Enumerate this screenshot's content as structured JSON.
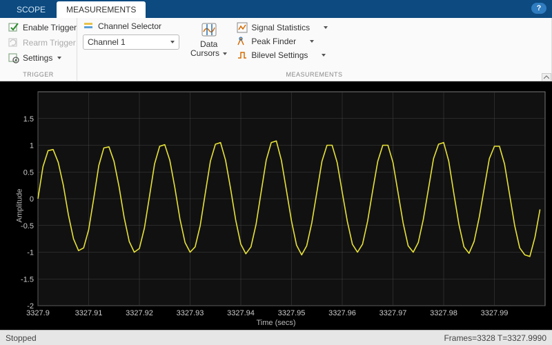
{
  "tabs": {
    "scope": "SCOPE",
    "measurements": "MEASUREMENTS"
  },
  "help_icon": "?",
  "trigger": {
    "enable": "Enable Trigger",
    "rearm": "Rearm Trigger",
    "settings": "Settings",
    "group": "TRIGGER"
  },
  "measurements": {
    "channel_selector": "Channel Selector",
    "channel_value": "Channel 1",
    "data_cursors": "Data",
    "data_cursors2": "Cursors",
    "signal_stats": "Signal Statistics",
    "peak_finder": "Peak Finder",
    "bilevel": "Bilevel Settings",
    "group": "MEASUREMENTS"
  },
  "status": {
    "left": "Stopped",
    "right": "Frames=3328  T=3327.9990"
  },
  "axes": {
    "ylabel": "Amplitude",
    "xlabel": "Time (secs)"
  },
  "chart_data": {
    "type": "line",
    "title": "",
    "xlabel": "Time (secs)",
    "ylabel": "Amplitude",
    "xlim": [
      3327.9,
      3328.0
    ],
    "ylim": [
      -2,
      2
    ],
    "yticks": [
      -2,
      -1.5,
      -1,
      -0.5,
      0,
      0.5,
      1,
      1.5
    ],
    "xticks": [
      3327.9,
      3327.91,
      3327.92,
      3327.93,
      3327.94,
      3327.95,
      3327.96,
      3327.97,
      3327.98,
      3327.99
    ],
    "series": [
      {
        "name": "Channel 1",
        "color": "#e8e337",
        "x": [
          3327.9,
          3327.901,
          3327.902,
          3327.903,
          3327.904,
          3327.905,
          3327.906,
          3327.907,
          3327.908,
          3327.909,
          3327.91,
          3327.911,
          3327.912,
          3327.913,
          3327.914,
          3327.915,
          3327.916,
          3327.917,
          3327.918,
          3327.919,
          3327.92,
          3327.921,
          3327.922,
          3327.923,
          3327.924,
          3327.925,
          3327.926,
          3327.927,
          3327.928,
          3327.929,
          3327.93,
          3327.931,
          3327.932,
          3327.933,
          3327.934,
          3327.935,
          3327.936,
          3327.937,
          3327.938,
          3327.939,
          3327.94,
          3327.941,
          3327.942,
          3327.943,
          3327.944,
          3327.945,
          3327.946,
          3327.947,
          3327.948,
          3327.949,
          3327.95,
          3327.951,
          3327.952,
          3327.953,
          3327.954,
          3327.955,
          3327.956,
          3327.957,
          3327.958,
          3327.959,
          3327.96,
          3327.961,
          3327.962,
          3327.963,
          3327.964,
          3327.965,
          3327.966,
          3327.967,
          3327.968,
          3327.969,
          3327.97,
          3327.971,
          3327.972,
          3327.973,
          3327.974,
          3327.975,
          3327.976,
          3327.977,
          3327.978,
          3327.979,
          3327.98,
          3327.981,
          3327.982,
          3327.983,
          3327.984,
          3327.985,
          3327.986,
          3327.987,
          3327.988,
          3327.989,
          3327.99,
          3327.991,
          3327.992,
          3327.993,
          3327.994,
          3327.995,
          3327.996,
          3327.997,
          3327.998,
          3327.999
        ],
        "y": [
          0.0,
          0.6,
          0.9,
          0.92,
          0.68,
          0.25,
          -0.3,
          -0.75,
          -0.97,
          -0.92,
          -0.58,
          0.0,
          0.62,
          0.95,
          0.97,
          0.7,
          0.22,
          -0.35,
          -0.8,
          -1.0,
          -0.93,
          -0.55,
          0.05,
          0.65,
          0.98,
          1.01,
          0.72,
          0.2,
          -0.38,
          -0.82,
          -1.0,
          -0.9,
          -0.5,
          0.1,
          0.7,
          1.02,
          1.05,
          0.72,
          0.18,
          -0.4,
          -0.85,
          -1.03,
          -0.9,
          -0.48,
          0.12,
          0.72,
          1.05,
          1.08,
          0.72,
          0.15,
          -0.42,
          -0.87,
          -1.05,
          -0.88,
          -0.45,
          0.12,
          0.7,
          1.0,
          1.0,
          0.68,
          0.12,
          -0.42,
          -0.85,
          -1.0,
          -0.85,
          -0.42,
          0.15,
          0.7,
          1.0,
          1.0,
          0.68,
          0.12,
          -0.45,
          -0.88,
          -1.0,
          -0.82,
          -0.38,
          0.18,
          0.75,
          1.02,
          1.05,
          0.7,
          0.1,
          -0.48,
          -0.9,
          -1.02,
          -0.8,
          -0.35,
          0.2,
          0.75,
          0.98,
          0.98,
          0.65,
          0.08,
          -0.5,
          -0.92,
          -1.05,
          -1.08,
          -0.72,
          -0.2
        ]
      }
    ]
  }
}
